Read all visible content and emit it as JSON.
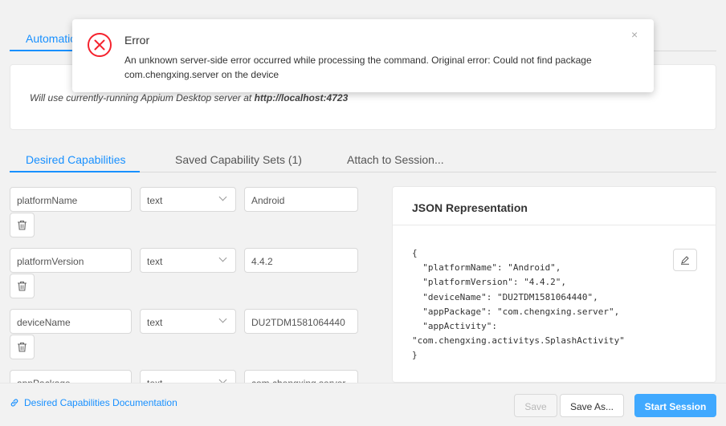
{
  "top_tabs": {
    "automatic": "Automatic Server"
  },
  "server_info": {
    "prefix": "Will use currently-running Appium Desktop server at ",
    "url": "http://localhost:4723"
  },
  "cap_tabs": {
    "desired": "Desired Capabilities",
    "saved": "Saved Capability Sets (1)",
    "attach": "Attach to Session..."
  },
  "capabilities": [
    {
      "name": "platformName",
      "type": "text",
      "value": "Android"
    },
    {
      "name": "platformVersion",
      "type": "text",
      "value": "4.4.2"
    },
    {
      "name": "deviceName",
      "type": "text",
      "value": "DU2TDM1581064440"
    },
    {
      "name": "appPackage",
      "type": "text",
      "value": "com.chengxing.server"
    }
  ],
  "json_panel": {
    "title": "JSON Representation",
    "body": "{\n  \"platformName\": \"Android\",\n  \"platformVersion\": \"4.4.2\",\n  \"deviceName\": \"DU2TDM1581064440\",\n  \"appPackage\": \"com.chengxing.server\",\n  \"appActivity\":\n\"com.chengxing.activitys.SplashActivity\"\n}"
  },
  "bottom": {
    "doc_link": "Desired Capabilities Documentation",
    "save": "Save",
    "save_as": "Save As...",
    "start": "Start Session"
  },
  "notification": {
    "title": "Error",
    "message": "An unknown server-side error occurred while processing the command. Original error: Could not find package com.chengxing.server on the device",
    "close": "×"
  },
  "colors": {
    "accent": "#1890ff",
    "primary_button": "#40a9ff",
    "error": "#f5222d"
  }
}
